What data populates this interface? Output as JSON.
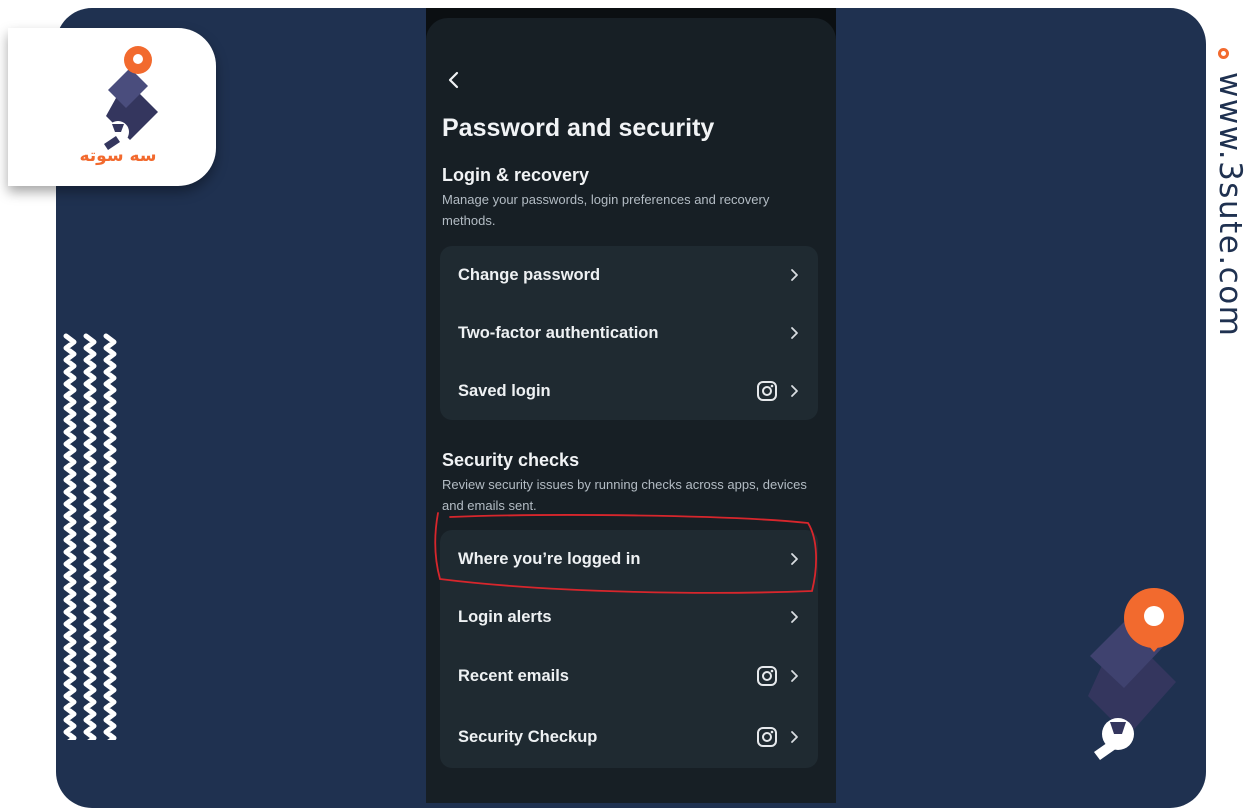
{
  "branding": {
    "logo_text_fa": "سه سوته",
    "website": "www.3sute.com",
    "colors": {
      "accent": "#f26a2e",
      "navy": "#1f3150",
      "logo_dark": "#34365e"
    }
  },
  "screen": {
    "back_icon": "chevron-left-icon",
    "title": "Password and security",
    "sections": [
      {
        "title": "Login & recovery",
        "description": "Manage your passwords, login preferences and recovery methods.",
        "items": [
          {
            "label": "Change password",
            "icons": [
              "chevron-right-icon"
            ]
          },
          {
            "label": "Two-factor authentication",
            "icons": [
              "chevron-right-icon"
            ]
          },
          {
            "label": "Saved login",
            "icons": [
              "instagram-icon",
              "chevron-right-icon"
            ]
          }
        ]
      },
      {
        "title": "Security checks",
        "description": "Review security issues by running checks across apps, devices and emails sent.",
        "items": [
          {
            "label": "Where you’re logged in",
            "icons": [
              "chevron-right-icon"
            ],
            "highlighted": true
          },
          {
            "label": "Login alerts",
            "icons": [
              "chevron-right-icon"
            ]
          },
          {
            "label": "Recent emails",
            "icons": [
              "instagram-icon",
              "chevron-right-icon"
            ]
          },
          {
            "label": "Security Checkup",
            "icons": [
              "instagram-icon",
              "chevron-right-icon"
            ]
          }
        ]
      }
    ]
  }
}
